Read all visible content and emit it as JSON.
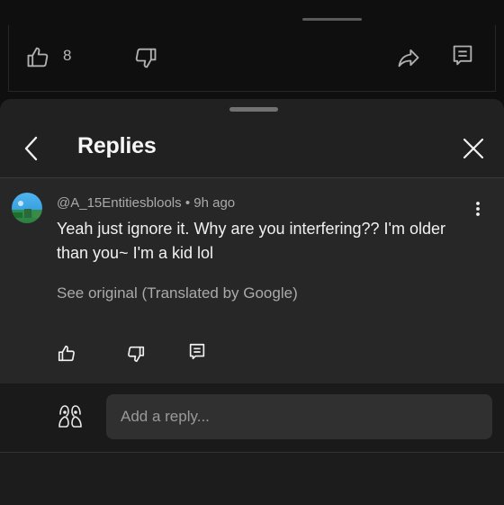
{
  "previous_comment": {
    "like_count": "8"
  },
  "sheet": {
    "title": "Replies"
  },
  "comment": {
    "author": "@A_15Entitiesblools",
    "separator": "•",
    "time_ago": "9h ago",
    "text": "Yeah just ignore it. Why are you interfering?? I'm older than you~ I'm a kid lol",
    "see_original": "See original (Translated by Google)"
  },
  "reply_input": {
    "placeholder": "Add a reply..."
  },
  "icons": {
    "like": "thumb-up-icon",
    "dislike": "thumb-down-icon",
    "share": "share-icon",
    "reply": "comment-icon",
    "back": "back-arrow-icon",
    "close": "close-icon",
    "more": "more-vertical-icon"
  },
  "colors": {
    "background": "#0f0f0f",
    "sheet": "#212121",
    "text_primary": "#f1f1f1",
    "text_secondary": "#aaaaaa"
  }
}
